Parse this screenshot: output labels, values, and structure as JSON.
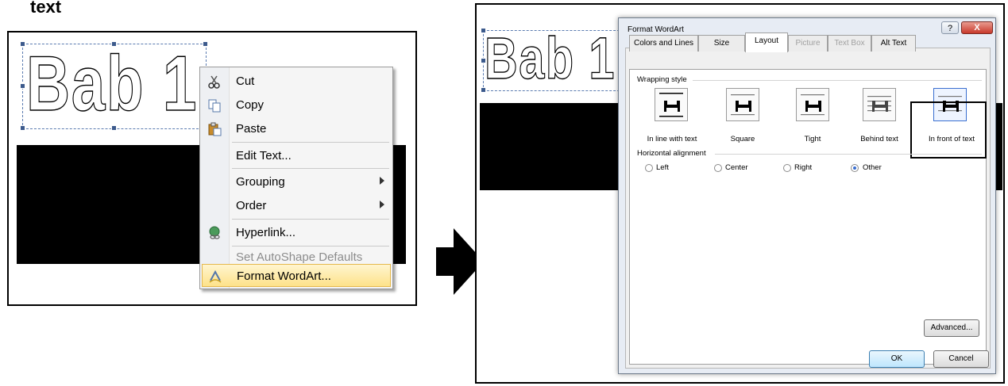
{
  "caption": "text",
  "left": {
    "wordart": "Bab 1",
    "context_menu": {
      "items": [
        {
          "label": "Cut",
          "icon": "scissors-icon",
          "submenu": false,
          "disabled": false
        },
        {
          "label": "Copy",
          "icon": "copy-icon",
          "submenu": false,
          "disabled": false
        },
        {
          "label": "Paste",
          "icon": "paste-icon",
          "submenu": false,
          "disabled": false
        },
        {
          "label": "Edit Text...",
          "icon": "",
          "submenu": false,
          "disabled": false
        },
        {
          "label": "Grouping",
          "icon": "",
          "submenu": true,
          "disabled": false
        },
        {
          "label": "Order",
          "icon": "",
          "submenu": true,
          "disabled": false
        },
        {
          "label": "Hyperlink...",
          "icon": "hyperlink-globe-icon",
          "submenu": false,
          "disabled": false
        },
        {
          "label": "Set AutoShape Defaults",
          "icon": "",
          "submenu": false,
          "disabled": true
        },
        {
          "label": "Format WordArt...",
          "icon": "format-wordart-icon",
          "submenu": false,
          "disabled": false,
          "highlighted": true
        }
      ]
    }
  },
  "arrow": {
    "icon": "right-arrow-icon",
    "color": "#000000"
  },
  "right": {
    "wordart": "Bab 1",
    "dialog": {
      "title": "Format WordArt",
      "help_label": "?",
      "close_label": "X",
      "tabs": [
        {
          "label": "Colors and Lines",
          "active": false,
          "disabled": false
        },
        {
          "label": "Size",
          "active": false,
          "disabled": false
        },
        {
          "label": "Layout",
          "active": true,
          "disabled": false
        },
        {
          "label": "Picture",
          "active": false,
          "disabled": true
        },
        {
          "label": "Text Box",
          "active": false,
          "disabled": true
        },
        {
          "label": "Alt Text",
          "active": false,
          "disabled": false
        }
      ],
      "wrapping_style_label": "Wrapping style",
      "wrapping_options": [
        {
          "label": "In line with text",
          "icon": "wrap-inline-icon"
        },
        {
          "label": "Square",
          "icon": "wrap-square-icon"
        },
        {
          "label": "Tight",
          "icon": "wrap-tight-icon"
        },
        {
          "label": "Behind text",
          "icon": "wrap-behind-icon"
        },
        {
          "label": "In front of text",
          "icon": "wrap-front-icon",
          "selected": true
        }
      ],
      "horizontal_alignment_label": "Horizontal alignment",
      "alignment_options": [
        {
          "label": "Left",
          "checked": false
        },
        {
          "label": "Center",
          "checked": false
        },
        {
          "label": "Right",
          "checked": false
        },
        {
          "label": "Other",
          "checked": true
        }
      ],
      "advanced_label": "Advanced...",
      "ok_label": "OK",
      "cancel_label": "Cancel"
    }
  }
}
